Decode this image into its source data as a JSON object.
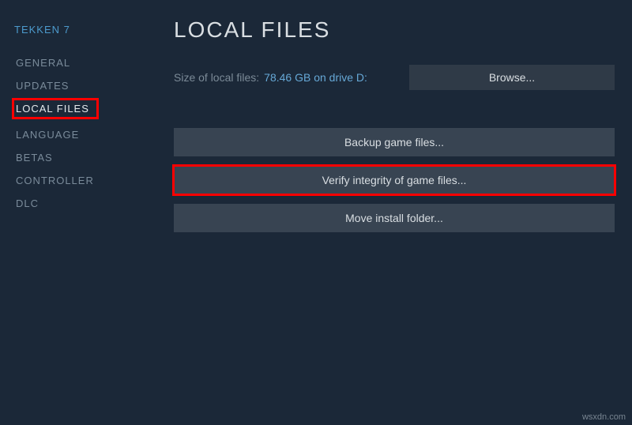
{
  "sidebar": {
    "game_title": "TEKKEN 7",
    "items": [
      {
        "label": "GENERAL"
      },
      {
        "label": "UPDATES"
      },
      {
        "label": "LOCAL FILES"
      },
      {
        "label": "LANGUAGE"
      },
      {
        "label": "BETAS"
      },
      {
        "label": "CONTROLLER"
      },
      {
        "label": "DLC"
      }
    ],
    "active_index": 2
  },
  "main": {
    "title": "LOCAL FILES",
    "size_label": "Size of local files:",
    "size_value": "78.46 GB on drive D:",
    "browse_label": "Browse...",
    "buttons": {
      "backup": "Backup game files...",
      "verify": "Verify integrity of game files...",
      "move": "Move install folder..."
    }
  },
  "watermark": "wsxdn.com"
}
